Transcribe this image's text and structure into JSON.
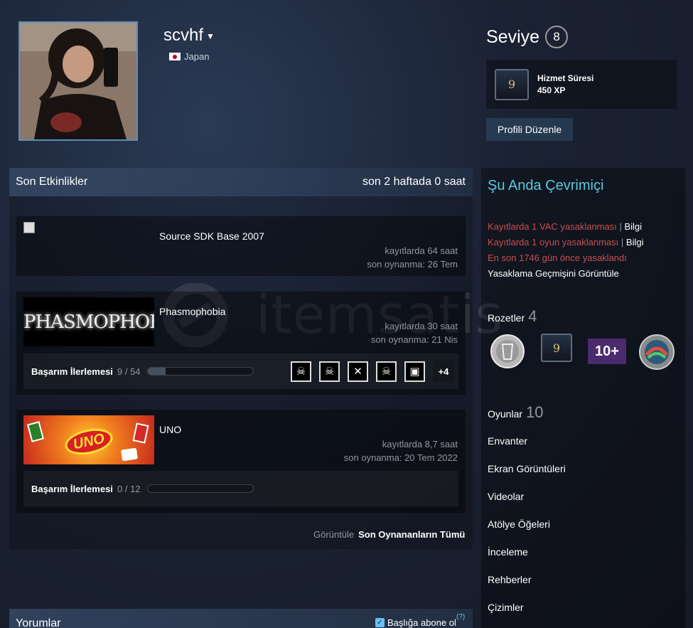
{
  "profile": {
    "persona_name": "scvhf",
    "country": "Japan",
    "level_label": "Seviye",
    "level": "8",
    "service_badge_title": "Hizmet Süresi",
    "service_badge_xp": "450 XP",
    "service_badge_years": "9",
    "edit_button": "Profili Düzenle"
  },
  "activity": {
    "title": "Son Etkinlikler",
    "summary": "son 2 haftada 0 saat",
    "games": [
      {
        "name": "Source SDK Base 2007",
        "hours": "kayıtlarda 64 saat",
        "last_played": "son oynanma: 26 Tem"
      },
      {
        "name": "Phasmophobia",
        "capsule_text": "PHASMOPHOBIA",
        "hours": "kayıtlarda 30 saat",
        "last_played": "son oynanma: 21 Nis",
        "achievement_label": "Başarım İlerlemesi",
        "achievement_count": "9 / 54",
        "achievement_progress": 0.17,
        "more_achievements": "+4"
      },
      {
        "name": "UNO",
        "capsule_text": "UNO",
        "hours": "kayıtlarda 8,7 saat",
        "last_played": "son oynanma: 20 Tem 2022",
        "achievement_label": "Başarım İlerlemesi",
        "achievement_count": "0 / 12",
        "achievement_progress": 0
      }
    ],
    "view_label": "Görüntüle",
    "view_all_link": "Son Oynananların Tümü"
  },
  "comments": {
    "title": "Yorumlar",
    "subscribe_label": "Başlığa abone ol",
    "help": "(?)"
  },
  "sidebar": {
    "status": "Şu Anda Çevrimiçi",
    "vac_ban": "Kayıtlarda 1 VAC yasaklanması",
    "game_ban": "Kayıtlarda 1 oyun yasaklanması",
    "info": "Bilgi",
    "last_ban": "En son 1746 gün önce yasaklandı",
    "ban_history": "Yasaklama Geçmişini Görüntüle",
    "badges_label": "Rozetler",
    "badges_count": "4",
    "badge_ten_plus": "10+",
    "games_label": "Oyunlar",
    "games_count": "10",
    "links": [
      "Envanter",
      "Ekran Görüntüleri",
      "Videolar",
      "Atölye Öğeleri",
      "İnceleme",
      "Rehberler",
      "Çizimler"
    ]
  },
  "watermark": "itemsatis",
  "colors": {
    "online": "#57cbde",
    "ban": "#c74f4f",
    "muted": "#8f98a0"
  }
}
